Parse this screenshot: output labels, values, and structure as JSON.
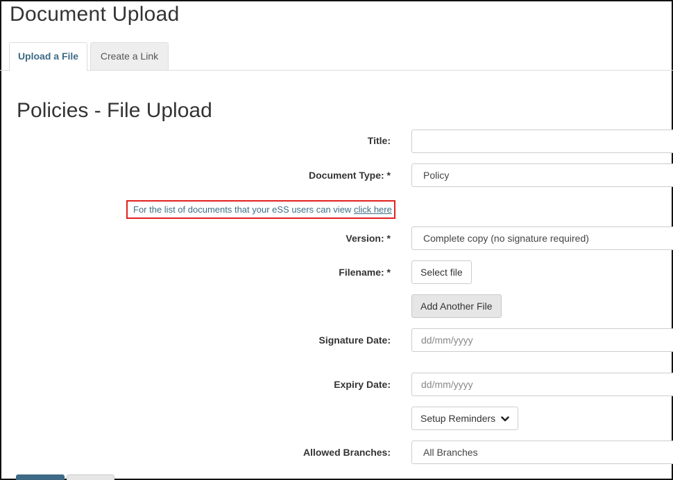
{
  "page": {
    "title": "Document Upload"
  },
  "tabs": [
    {
      "label": "Upload a File",
      "active": true
    },
    {
      "label": "Create a Link",
      "active": false
    }
  ],
  "section": {
    "title": "Policies - File Upload"
  },
  "form": {
    "title": {
      "label": "Title:",
      "value": ""
    },
    "document_type": {
      "label": "Document Type: *",
      "value": "Policy"
    },
    "ess_note": {
      "text": "For the list of documents that your eSS users can view ",
      "link": "click here"
    },
    "version": {
      "label": "Version: *",
      "value": "Complete copy (no signature required)"
    },
    "filename": {
      "label": "Filename: *",
      "select_button": "Select file",
      "add_button": "Add Another File"
    },
    "signature_date": {
      "label": "Signature Date:",
      "placeholder": "dd/mm/yyyy"
    },
    "expiry_date": {
      "label": "Expiry Date:",
      "placeholder": "dd/mm/yyyy"
    },
    "reminders": {
      "button": "Setup Reminders",
      "icon": "chevron-down-icon"
    },
    "allowed_branches": {
      "label": "Allowed Branches:",
      "value": "All Branches"
    }
  },
  "colors": {
    "accent": "#3e6a85",
    "highlight_border": "#e0201f",
    "link": "#3d6f86"
  }
}
